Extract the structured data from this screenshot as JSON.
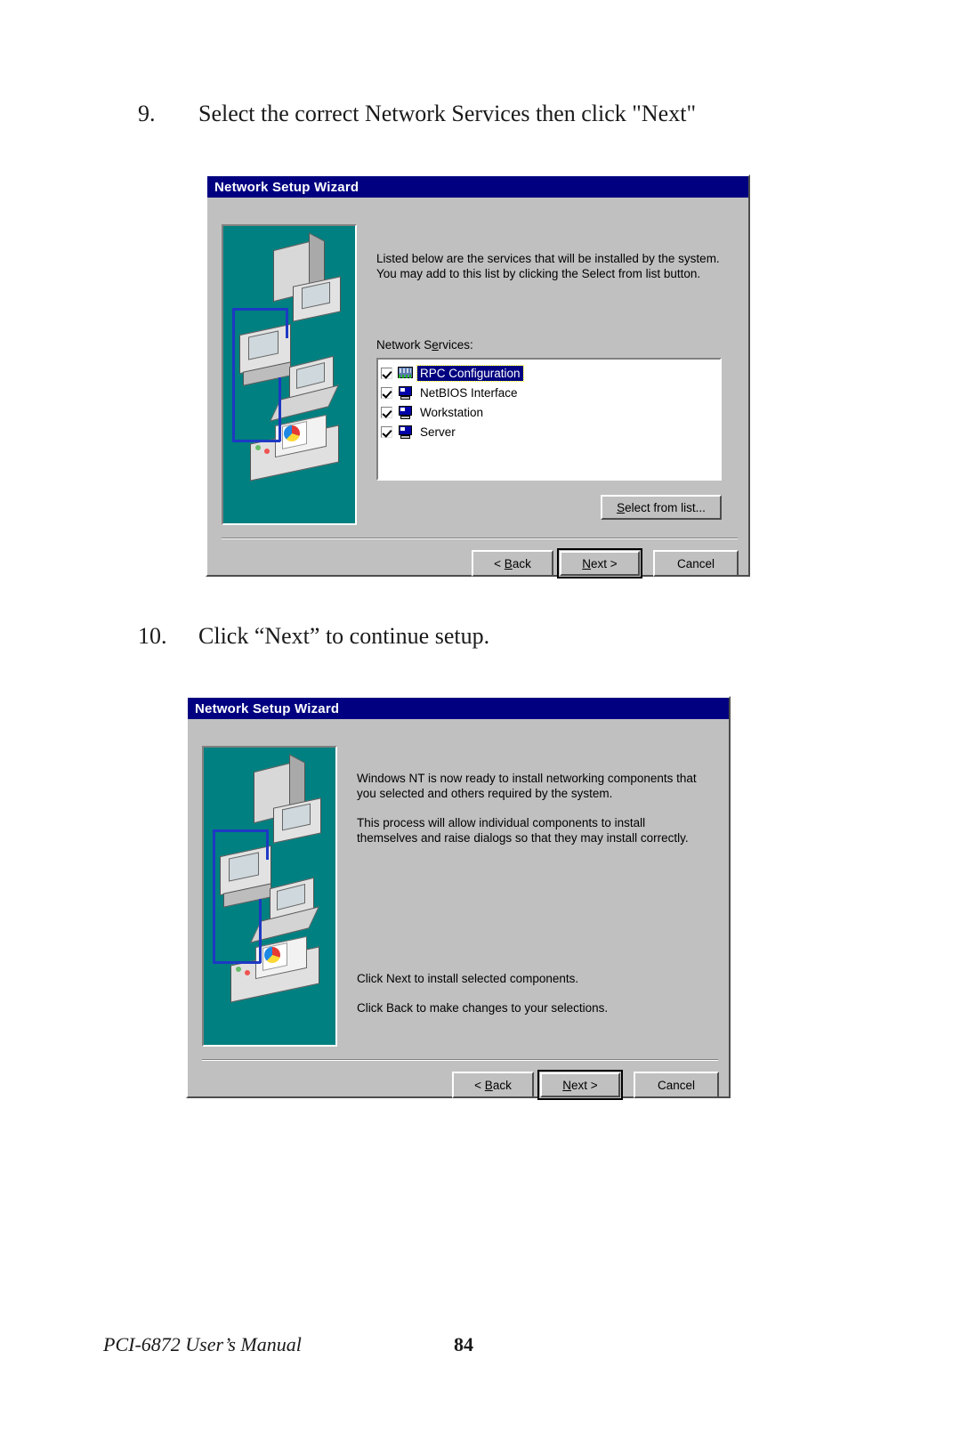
{
  "page": {
    "steps": [
      {
        "number": "9.",
        "text": "Select the correct Network Services then click \"Next\""
      },
      {
        "number": "10.",
        "text": "Click “Next” to continue setup."
      }
    ],
    "footer": {
      "manual_title": "PCI-6872 User’s Manual",
      "page_number": "84"
    }
  },
  "dialog1": {
    "title": "Network Setup Wizard",
    "intro_text": "Listed below are the services that will be installed by the system.\nYou may add to this list by clicking the Select from list button.",
    "list_label": "Network Services:",
    "services": [
      {
        "name": "RPC Configuration",
        "checked": true,
        "selected": true,
        "icon": "chip-icon"
      },
      {
        "name": "NetBIOS Interface",
        "checked": true,
        "selected": false,
        "icon": "monitor-icon"
      },
      {
        "name": "Workstation",
        "checked": true,
        "selected": false,
        "icon": "monitor-icon"
      },
      {
        "name": "Server",
        "checked": true,
        "selected": false,
        "icon": "monitor-icon"
      }
    ],
    "select_from_list_button": "Select from list...",
    "back_button": "< Back",
    "next_button": "Next >",
    "cancel_button": "Cancel"
  },
  "dialog2": {
    "title": "Network Setup Wizard",
    "paragraph1": "Windows NT is now ready to install networking components that\nyou selected and others required by the system.",
    "paragraph2": "This process will allow individual components to install\nthemselves and raise dialogs so that they may install correctly.",
    "paragraph3": "Click Next to install selected components.",
    "paragraph4": "Click Back to make changes to your selections.",
    "back_button": "< Back",
    "next_button": "Next >",
    "cancel_button": "Cancel"
  },
  "colors": {
    "titlebar": "#000080",
    "dialog_face": "#c0c0c0",
    "graphic_panel": "#008080",
    "selection": "#000080",
    "network_cable": "#1d39c4"
  }
}
